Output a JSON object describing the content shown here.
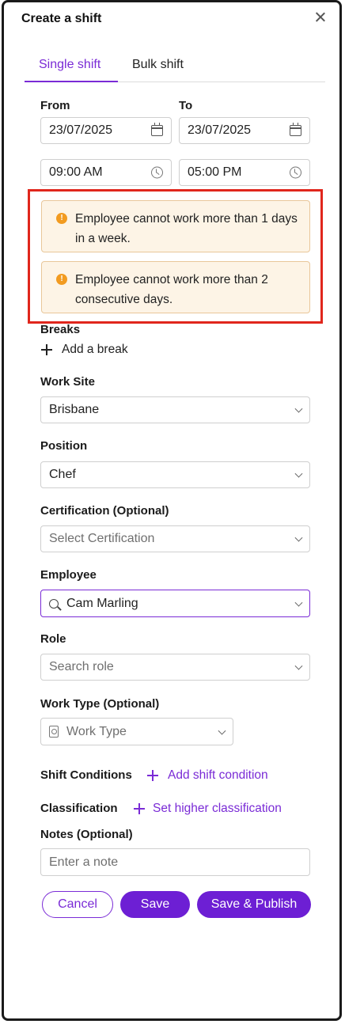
{
  "dialog": {
    "title": "Create a shift"
  },
  "tabs": [
    {
      "label": "Single shift",
      "active": true
    },
    {
      "label": "Bulk shift",
      "active": false
    }
  ],
  "from": {
    "label": "From",
    "date": "23/07/2025",
    "time": "09:00 AM"
  },
  "to": {
    "label": "To",
    "date": "23/07/2025",
    "time": "05:00 PM"
  },
  "alerts": [
    {
      "text": "Employee cannot work more than 1 days in a week.",
      "icon": "warning-icon"
    },
    {
      "text": "Employee cannot work more than 2 consecutive days.",
      "icon": "warning-icon"
    }
  ],
  "breaks": {
    "label": "Breaks",
    "add_label": "Add a break"
  },
  "work_site": {
    "label": "Work Site",
    "value": "Brisbane"
  },
  "position": {
    "label": "Position",
    "value": "Chef"
  },
  "certification": {
    "label": "Certification (Optional)",
    "placeholder": "Select Certification"
  },
  "employee": {
    "label": "Employee",
    "value": "Cam Marling"
  },
  "role": {
    "label": "Role",
    "placeholder": "Search role"
  },
  "work_type": {
    "label": "Work Type (Optional)",
    "placeholder": "Work Type"
  },
  "shift_conditions": {
    "label": "Shift Conditions",
    "add_label": "Add shift condition"
  },
  "classification": {
    "label": "Classification",
    "add_label": "Set higher classification"
  },
  "notes": {
    "label": "Notes (Optional)",
    "placeholder": "Enter a note"
  },
  "buttons": {
    "cancel": "Cancel",
    "save": "Save",
    "publish": "Save & Publish"
  },
  "colors": {
    "accent": "#6d1fd4",
    "alert_bg": "#fdf4e6",
    "alert_border": "#e9c79a",
    "highlight": "#e0261c"
  }
}
